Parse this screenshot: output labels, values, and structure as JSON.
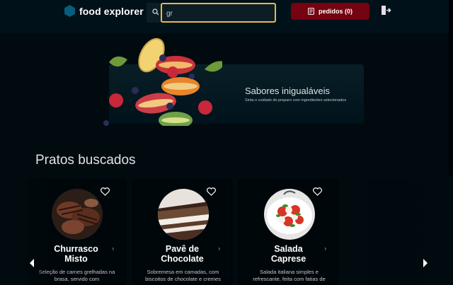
{
  "header": {
    "brand": "food explorer",
    "brand_icon": "hexagon-logo-icon",
    "search": {
      "value": "gr",
      "placeholder": ""
    },
    "orders_label": "pedidos (0)",
    "colors": {
      "accent": "#e8b84a",
      "orders_bg": "#750310",
      "brand": "#065e7c"
    }
  },
  "banner": {
    "title": "Sabores inigualáveis",
    "subtitle": "Sinta o cuidado do preparo com ingredientes selecionados"
  },
  "results": {
    "title": "Pratos buscados",
    "cards": [
      {
        "name_line1": "Churrasco",
        "name_line2": "Misto",
        "description": "Seleção de carnes grelhadas na brasa, servido com"
      },
      {
        "name_line1": "Pavê de",
        "name_line2": "Chocolate",
        "description": "Sobremesa em camadas, com biscoitos de chocolate e cremes"
      },
      {
        "name_line1": "Salada",
        "name_line2": "Caprese",
        "description": "Salada italiana simples e refrescante, feita com fatias de"
      }
    ]
  }
}
